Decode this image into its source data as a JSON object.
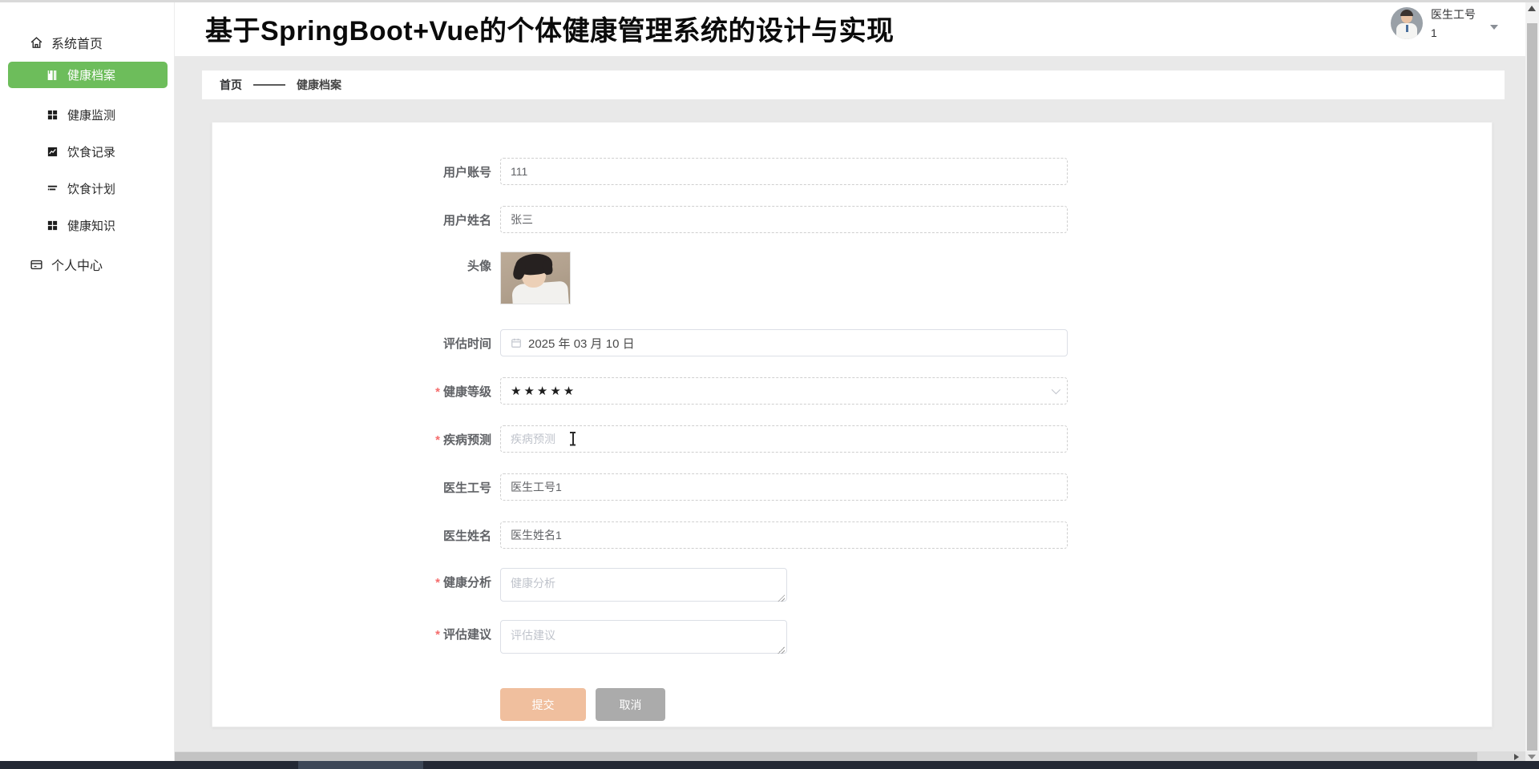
{
  "header": {
    "title": "基于SpringBoot+Vue的个体健康管理系统的设计与实现",
    "user": {
      "label": "医生工号",
      "sub": "1",
      "avatar_icon": "doctor-avatar"
    }
  },
  "sidebar": {
    "items": [
      {
        "label": "系统首页",
        "icon": "home-icon",
        "active": false
      },
      {
        "label": "健康档案",
        "icon": "archive-icon",
        "active": true
      },
      {
        "label": "健康监测",
        "icon": "grid-icon",
        "active": false
      },
      {
        "label": "饮食记录",
        "icon": "chart-icon",
        "active": false
      },
      {
        "label": "饮食计划",
        "icon": "list-icon",
        "active": false
      },
      {
        "label": "健康知识",
        "icon": "grid-icon",
        "active": false
      },
      {
        "label": "个人中心",
        "icon": "card-icon",
        "active": false
      }
    ]
  },
  "breadcrumb": {
    "home": "首页",
    "current": "健康档案"
  },
  "form": {
    "required_marker": "*",
    "rows": [
      {
        "label": "用户账号",
        "value": "111"
      },
      {
        "label": "用户姓名",
        "value": "张三"
      },
      {
        "label": "头像"
      },
      {
        "label": "评估时间",
        "value": "2025 年 03 月 10 日",
        "icon": "calendar-icon"
      },
      {
        "label": "健康等级",
        "required": true,
        "value": "★★★★★",
        "icon": "chevron-down-icon"
      },
      {
        "label": "疾病预测",
        "required": true,
        "placeholder": "疾病预测"
      },
      {
        "label": "医生工号",
        "value": "医生工号1"
      },
      {
        "label": "医生姓名",
        "value": "医生姓名1"
      },
      {
        "label": "健康分析",
        "required": true,
        "placeholder": "健康分析"
      },
      {
        "label": "评估建议",
        "required": true,
        "placeholder": "评估建议"
      }
    ],
    "buttons": {
      "submit": "提交",
      "cancel": "取消"
    }
  },
  "colors": {
    "sidebar_active": "#6dbd5b",
    "submit_button": "#f0bf9e",
    "cancel_button": "#ababab",
    "required_marker": "#f56c6c",
    "content_background": "#e9e9e9"
  }
}
